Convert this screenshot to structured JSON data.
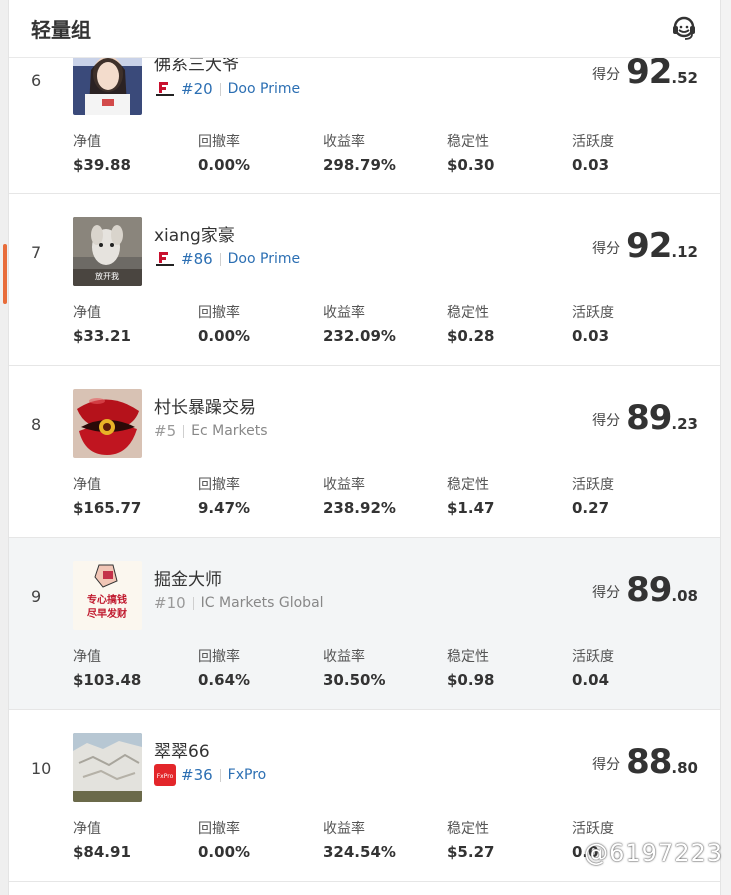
{
  "header": {
    "title": "轻量组"
  },
  "labels": {
    "score": "得分",
    "net_value": "净值",
    "drawdown": "回撤率",
    "return_rate": "收益率",
    "stability": "稳定性",
    "activity": "活跃度"
  },
  "rows": [
    {
      "rank": "6",
      "name": "佛系三大爷",
      "broker_rank": "#20",
      "broker": "Doo Prime",
      "score_int": "92",
      "score_dec": ".52",
      "net_value": "$39.88",
      "drawdown": "0.00%",
      "return_rate": "298.79%",
      "stability": "$0.30",
      "activity": "0.03"
    },
    {
      "rank": "7",
      "name": "xiang家豪",
      "broker_rank": "#86",
      "broker": "Doo Prime",
      "score_int": "92",
      "score_dec": ".12",
      "net_value": "$33.21",
      "drawdown": "0.00%",
      "return_rate": "232.09%",
      "stability": "$0.28",
      "activity": "0.03",
      "avatar_caption": "放开我"
    },
    {
      "rank": "8",
      "name": "村长暴躁交易",
      "broker_rank": "#5",
      "broker": "Ec Markets",
      "score_int": "89",
      "score_dec": ".23",
      "net_value": "$165.77",
      "drawdown": "9.47%",
      "return_rate": "238.92%",
      "stability": "$1.47",
      "activity": "0.27"
    },
    {
      "rank": "9",
      "name": "掘金大师",
      "broker_rank": "#10",
      "broker": "IC Markets Global",
      "score_int": "89",
      "score_dec": ".08",
      "net_value": "$103.48",
      "drawdown": "0.64%",
      "return_rate": "30.50%",
      "stability": "$0.98",
      "activity": "0.04",
      "avatar_text": [
        "专心搞钱",
        "尽早发财"
      ]
    },
    {
      "rank": "10",
      "name": "翠翠66",
      "broker_rank": "#36",
      "broker": "FxPro",
      "score_int": "88",
      "score_dec": ".80",
      "net_value": "$84.91",
      "drawdown": "0.00%",
      "return_rate": "324.54%",
      "stability": "$5.27",
      "activity": "0.0",
      "broker_logo_text": "FxPro"
    }
  ],
  "watermark": "@6197223",
  "colors": {
    "link_blue": "#2c6fb3",
    "accent_orange": "#e86c3a",
    "highlight_row": "#f3f5f6",
    "fxpro_red": "#e3262a"
  },
  "icons": {
    "support": "headset-icon"
  }
}
